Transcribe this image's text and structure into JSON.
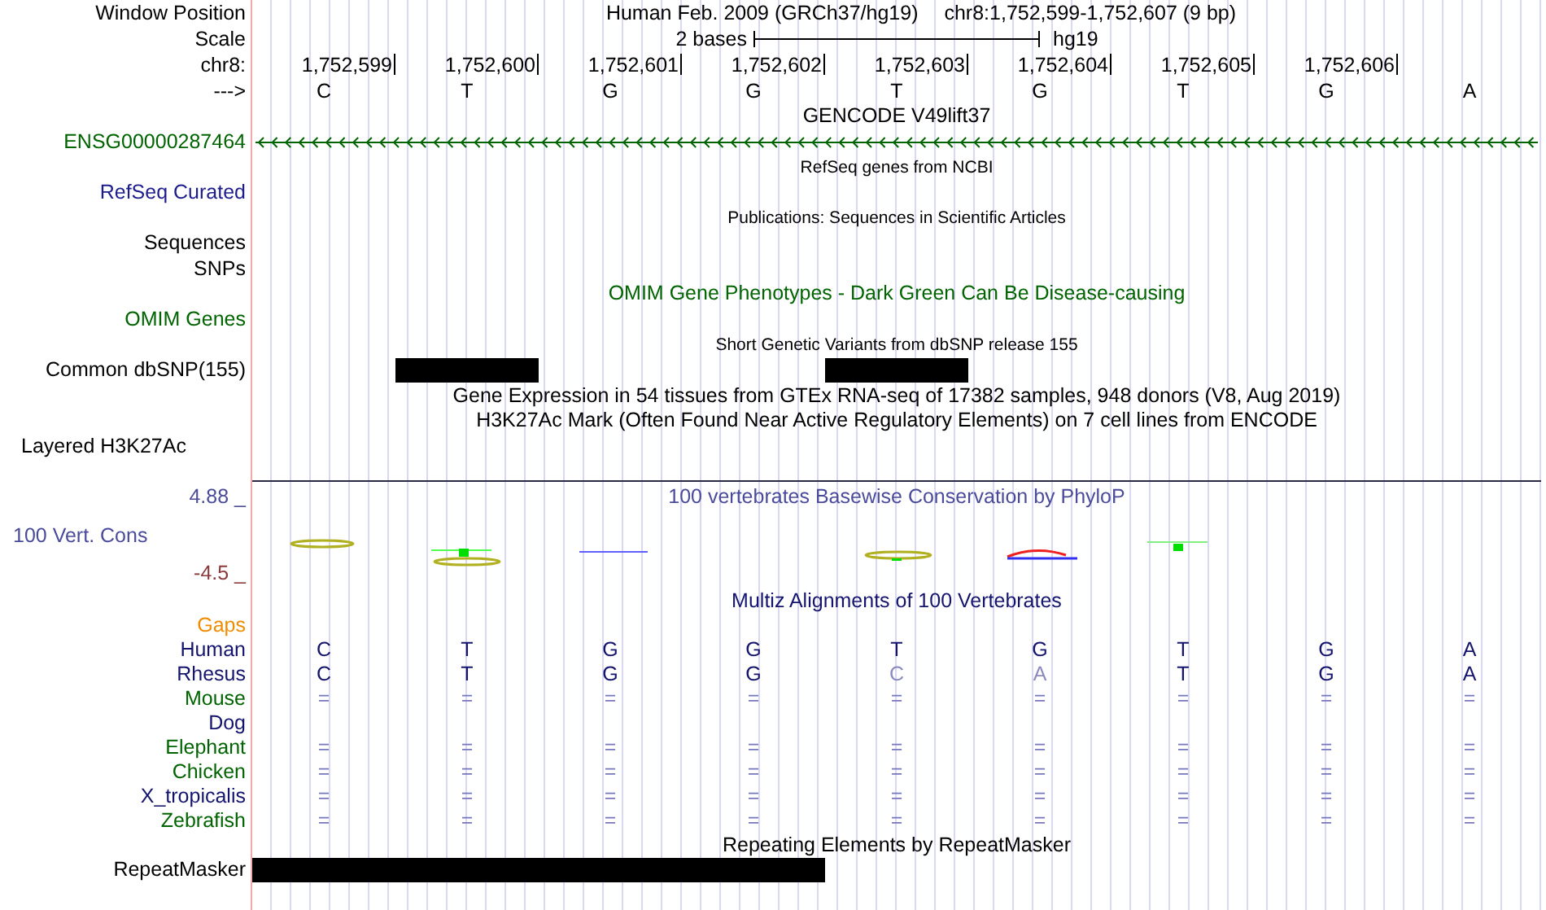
{
  "position": {
    "label": "Window Position",
    "assembly": "Human Feb. 2009 (GRCh37/hg19)",
    "range": "chr8:1,752,599-1,752,607 (9 bp)"
  },
  "scale": {
    "label": "Scale",
    "span": "2 bases",
    "db": "hg19"
  },
  "ruler": {
    "label": "chr8:",
    "ticks": [
      "1,752,599",
      "1,752,600",
      "1,752,601",
      "1,752,602",
      "1,752,603",
      "1,752,604",
      "1,752,605",
      "1,752,606"
    ]
  },
  "sequence": {
    "label": "--->",
    "bases": [
      "C",
      "T",
      "G",
      "G",
      "T",
      "G",
      "T",
      "G",
      "A"
    ]
  },
  "tracks": [
    {
      "kind": "title",
      "text": "GENCODE V49lift37",
      "color": "#000000"
    },
    {
      "kind": "gene",
      "label": "ENSG00000287464",
      "color": "#006400",
      "reverse_strand": true
    },
    {
      "kind": "caption",
      "text": "RefSeq genes from NCBI",
      "color": "#000000"
    },
    {
      "kind": "label",
      "label": "RefSeq Curated",
      "color": "#1c1c8c"
    },
    {
      "kind": "caption",
      "text": "Publications: Sequences in Scientific Articles",
      "color": "#000000"
    },
    {
      "kind": "label",
      "label": "Sequences",
      "color": "#000000"
    },
    {
      "kind": "label",
      "label": "SNPs",
      "color": "#000000"
    },
    {
      "kind": "title",
      "text": "OMIM Gene Phenotypes - Dark Green Can Be Disease-causing",
      "color": "#006400"
    },
    {
      "kind": "label",
      "label": "OMIM Genes",
      "color": "#006400"
    },
    {
      "kind": "caption",
      "text": "Short Genetic Variants from dbSNP release 155",
      "color": "#000000"
    },
    {
      "kind": "bars",
      "label": "Common dbSNP(155)",
      "color": "#000000",
      "cells": [
        {
          "filled": false
        },
        {
          "filled": true
        },
        {
          "filled": false
        },
        {
          "filled": false
        },
        {
          "filled": true
        },
        {
          "filled": false
        },
        {
          "filled": false
        },
        {
          "filled": false
        },
        {
          "filled": false
        }
      ]
    },
    {
      "kind": "title",
      "text": "Gene Expression in 54 tissues from GTEx RNA-seq of 17382 samples, 948 donors (V8, Aug 2019)",
      "color": "#000000"
    },
    {
      "kind": "title",
      "text": "H3K27Ac Mark (Often Found Near Active Regulatory Elements) on 7 cell lines from ENCODE",
      "color": "#000000"
    },
    {
      "kind": "composite",
      "label": "Layered H3K27Ac",
      "color": "#000000"
    },
    {
      "kind": "wiggle",
      "title": "100 vertebrates Basewise Conservation by PhyloP",
      "label": "100 Vert. Cons",
      "max": "4.88 _",
      "min": "-4.5 _",
      "color": "#4b4b9b"
    },
    {
      "kind": "title",
      "text": "Multiz Alignments of 100 Vertebrates",
      "color": "#14146e"
    },
    {
      "kind": "label",
      "label": "Gaps",
      "color": "#f08c00"
    },
    {
      "kind": "alignment",
      "label": "Human",
      "color": "#14146e",
      "cells": [
        {
          "base": "C",
          "mismatch": false
        },
        {
          "base": "T",
          "mismatch": false
        },
        {
          "base": "G",
          "mismatch": false
        },
        {
          "base": "G",
          "mismatch": false
        },
        {
          "base": "T",
          "mismatch": false
        },
        {
          "base": "G",
          "mismatch": false
        },
        {
          "base": "T",
          "mismatch": false
        },
        {
          "base": "G",
          "mismatch": false
        },
        {
          "base": "A",
          "mismatch": false
        }
      ]
    },
    {
      "kind": "alignment",
      "label": "Rhesus",
      "color": "#14146e",
      "cells": [
        {
          "base": "C",
          "mismatch": false
        },
        {
          "base": "T",
          "mismatch": false
        },
        {
          "base": "G",
          "mismatch": false
        },
        {
          "base": "G",
          "mismatch": false
        },
        {
          "base": "C",
          "mismatch": true
        },
        {
          "base": "A",
          "mismatch": true
        },
        {
          "base": "T",
          "mismatch": false
        },
        {
          "base": "G",
          "mismatch": false
        },
        {
          "base": "A",
          "mismatch": false
        }
      ]
    },
    {
      "kind": "alignment",
      "label": "Mouse",
      "color": "#006400",
      "cells": [
        {
          "base": "=",
          "mismatch": false
        },
        {
          "base": "=",
          "mismatch": false
        },
        {
          "base": "=",
          "mismatch": false
        },
        {
          "base": "=",
          "mismatch": false
        },
        {
          "base": "=",
          "mismatch": false
        },
        {
          "base": "=",
          "mismatch": false
        },
        {
          "base": "=",
          "mismatch": false
        },
        {
          "base": "=",
          "mismatch": false
        },
        {
          "base": "=",
          "mismatch": false
        }
      ]
    },
    {
      "kind": "alignment",
      "label": "Dog",
      "color": "#14146e"
    },
    {
      "kind": "alignment",
      "label": "Elephant",
      "color": "#006400",
      "cells": [
        {
          "base": "=",
          "mismatch": false
        },
        {
          "base": "=",
          "mismatch": false
        },
        {
          "base": "=",
          "mismatch": false
        },
        {
          "base": "=",
          "mismatch": false
        },
        {
          "base": "=",
          "mismatch": false
        },
        {
          "base": "=",
          "mismatch": false
        },
        {
          "base": "=",
          "mismatch": false
        },
        {
          "base": "=",
          "mismatch": false
        },
        {
          "base": "=",
          "mismatch": false
        }
      ]
    },
    {
      "kind": "alignment",
      "label": "Chicken",
      "color": "#006400",
      "cells": [
        {
          "base": "=",
          "mismatch": false
        },
        {
          "base": "=",
          "mismatch": false
        },
        {
          "base": "=",
          "mismatch": false
        },
        {
          "base": "=",
          "mismatch": false
        },
        {
          "base": "=",
          "mismatch": false
        },
        {
          "base": "=",
          "mismatch": false
        },
        {
          "base": "=",
          "mismatch": false
        },
        {
          "base": "=",
          "mismatch": false
        },
        {
          "base": "=",
          "mismatch": false
        }
      ]
    },
    {
      "kind": "alignment",
      "label": "X_tropicalis",
      "color": "#14146e",
      "cells": [
        {
          "base": "=",
          "mismatch": false
        },
        {
          "base": "=",
          "mismatch": false
        },
        {
          "base": "=",
          "mismatch": false
        },
        {
          "base": "=",
          "mismatch": false
        },
        {
          "base": "=",
          "mismatch": false
        },
        {
          "base": "=",
          "mismatch": false
        },
        {
          "base": "=",
          "mismatch": false
        },
        {
          "base": "=",
          "mismatch": false
        },
        {
          "base": "=",
          "mismatch": false
        }
      ]
    },
    {
      "kind": "alignment",
      "label": "Zebrafish",
      "color": "#006400",
      "cells": [
        {
          "base": "=",
          "mismatch": false
        },
        {
          "base": "=",
          "mismatch": false
        },
        {
          "base": "=",
          "mismatch": false
        },
        {
          "base": "=",
          "mismatch": false
        },
        {
          "base": "=",
          "mismatch": false
        },
        {
          "base": "=",
          "mismatch": false
        },
        {
          "base": "=",
          "mismatch": false
        },
        {
          "base": "=",
          "mismatch": false
        },
        {
          "base": "=",
          "mismatch": false
        }
      ]
    },
    {
      "kind": "title",
      "text": "Repeating Elements by RepeatMasker",
      "color": "#000000"
    },
    {
      "kind": "bars",
      "label": "RepeatMasker",
      "color": "#000000",
      "cells": [
        {
          "filled": true
        },
        {
          "filled": true
        },
        {
          "filled": true
        },
        {
          "filled": true
        },
        {
          "filled": false
        },
        {
          "filled": false
        },
        {
          "filled": false
        },
        {
          "filled": false
        },
        {
          "filled": false
        }
      ]
    }
  ]
}
